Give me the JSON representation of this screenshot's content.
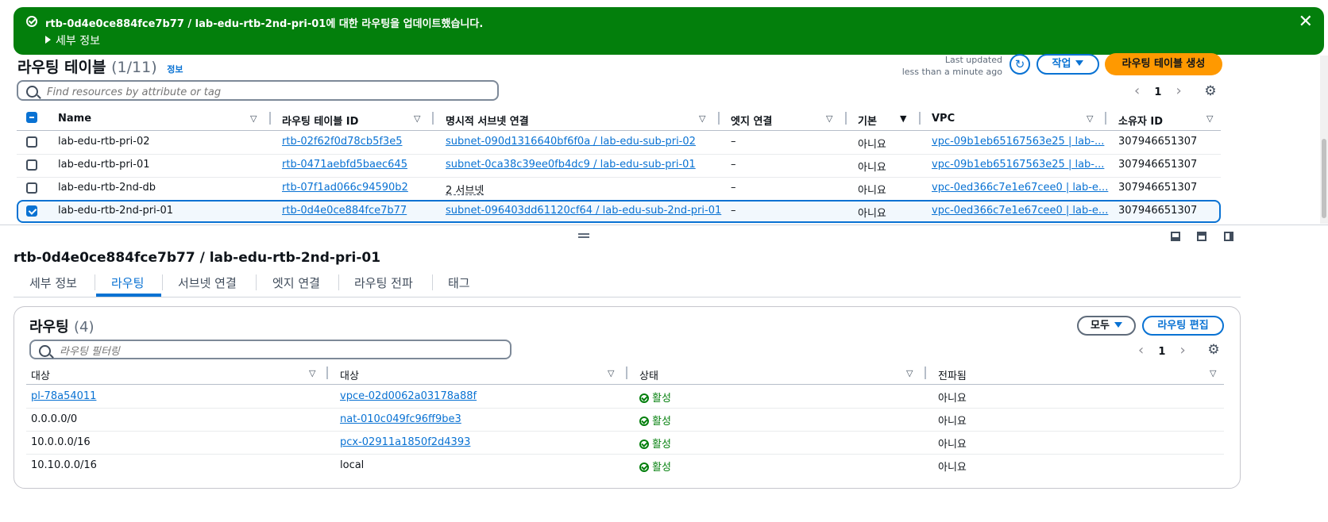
{
  "flash": {
    "message": "rtb-0d4e0ce884fce7b77 / lab-edu-rtb-2nd-pri-01에 대한 라우팅을 업데이트했습니다.",
    "details_label": "세부 정보",
    "close_label": "✕",
    "color": "#037f0c"
  },
  "table_header": {
    "title": "라우팅 테이블",
    "count": "(1/11)",
    "info": "정보",
    "last_updated_label": "Last updated",
    "last_updated_value": "less than a minute ago",
    "actions_label": "작업",
    "create_label": "라우팅 테이블 생성",
    "search_placeholder": "Find resources by attribute or tag",
    "page": "1"
  },
  "route_tables": {
    "columns": [
      "Name",
      "라우팅 테이블 ID",
      "명시적 서브넷 연결",
      "엣지 연결",
      "기본",
      "VPC",
      "소유자 ID"
    ],
    "rows": [
      {
        "name": "lab-edu-rtb-pri-02",
        "id": "rtb-02f62f0d78cb5f3e5",
        "subnet": "subnet-090d1316640bf6f0a / lab-edu-sub-pri-02",
        "edge": "–",
        "main": "아니요",
        "vpc": "vpc-09b1eb65167563e25 | lab-...",
        "owner": "307946651307",
        "selected": false
      },
      {
        "name": "lab-edu-rtb-pri-01",
        "id": "rtb-0471aebfd5baec645",
        "subnet": "subnet-0ca38c39ee0fb4dc9 / lab-edu-sub-pri-01",
        "edge": "–",
        "main": "아니요",
        "vpc": "vpc-09b1eb65167563e25 | lab-...",
        "owner": "307946651307",
        "selected": false
      },
      {
        "name": "lab-edu-rtb-2nd-db",
        "id": "rtb-07f1ad066c94590b2",
        "subnet": "2 서브넷",
        "edge": "–",
        "main": "아니요",
        "vpc": "vpc-0ed366c7e1e67cee0 | lab-e...",
        "owner": "307946651307",
        "selected": false
      },
      {
        "name": "lab-edu-rtb-2nd-pri-01",
        "id": "rtb-0d4e0ce884fce7b77",
        "subnet": "subnet-096403dd61120cf64 / lab-edu-sub-2nd-pri-01",
        "edge": "–",
        "main": "아니요",
        "vpc": "vpc-0ed366c7e1e67cee0 | lab-e...",
        "owner": "307946651307",
        "selected": true
      }
    ]
  },
  "detail": {
    "title": "rtb-0d4e0ce884fce7b77 / lab-edu-rtb-2nd-pri-01",
    "tabs": [
      "세부 정보",
      "라우팅",
      "서브넷 연결",
      "엣지 연결",
      "라우팅 전파",
      "태그"
    ],
    "active_tab": "라우팅"
  },
  "routes": {
    "title": "라우팅",
    "count": "(4)",
    "filter_label": "모두",
    "edit_label": "라우팅 편집",
    "search_placeholder": "라우팅 필터링",
    "page": "1",
    "columns": [
      "대상",
      "대상",
      "상태",
      "전파됨"
    ],
    "rows": [
      {
        "destination": "pl-78a54011",
        "target": "vpce-02d0062a03178a88f",
        "status": "활성",
        "propagated": "아니요"
      },
      {
        "destination": "0.0.0.0/0",
        "target": "nat-010c049fc96ff9be3",
        "status": "활성",
        "propagated": "아니요"
      },
      {
        "destination": "10.0.0.0/16",
        "target": "pcx-02911a1850f2d4393",
        "status": "활성",
        "propagated": "아니요"
      },
      {
        "destination": "10.10.0.0/16",
        "target": "local",
        "status": "활성",
        "propagated": "아니요"
      }
    ]
  }
}
